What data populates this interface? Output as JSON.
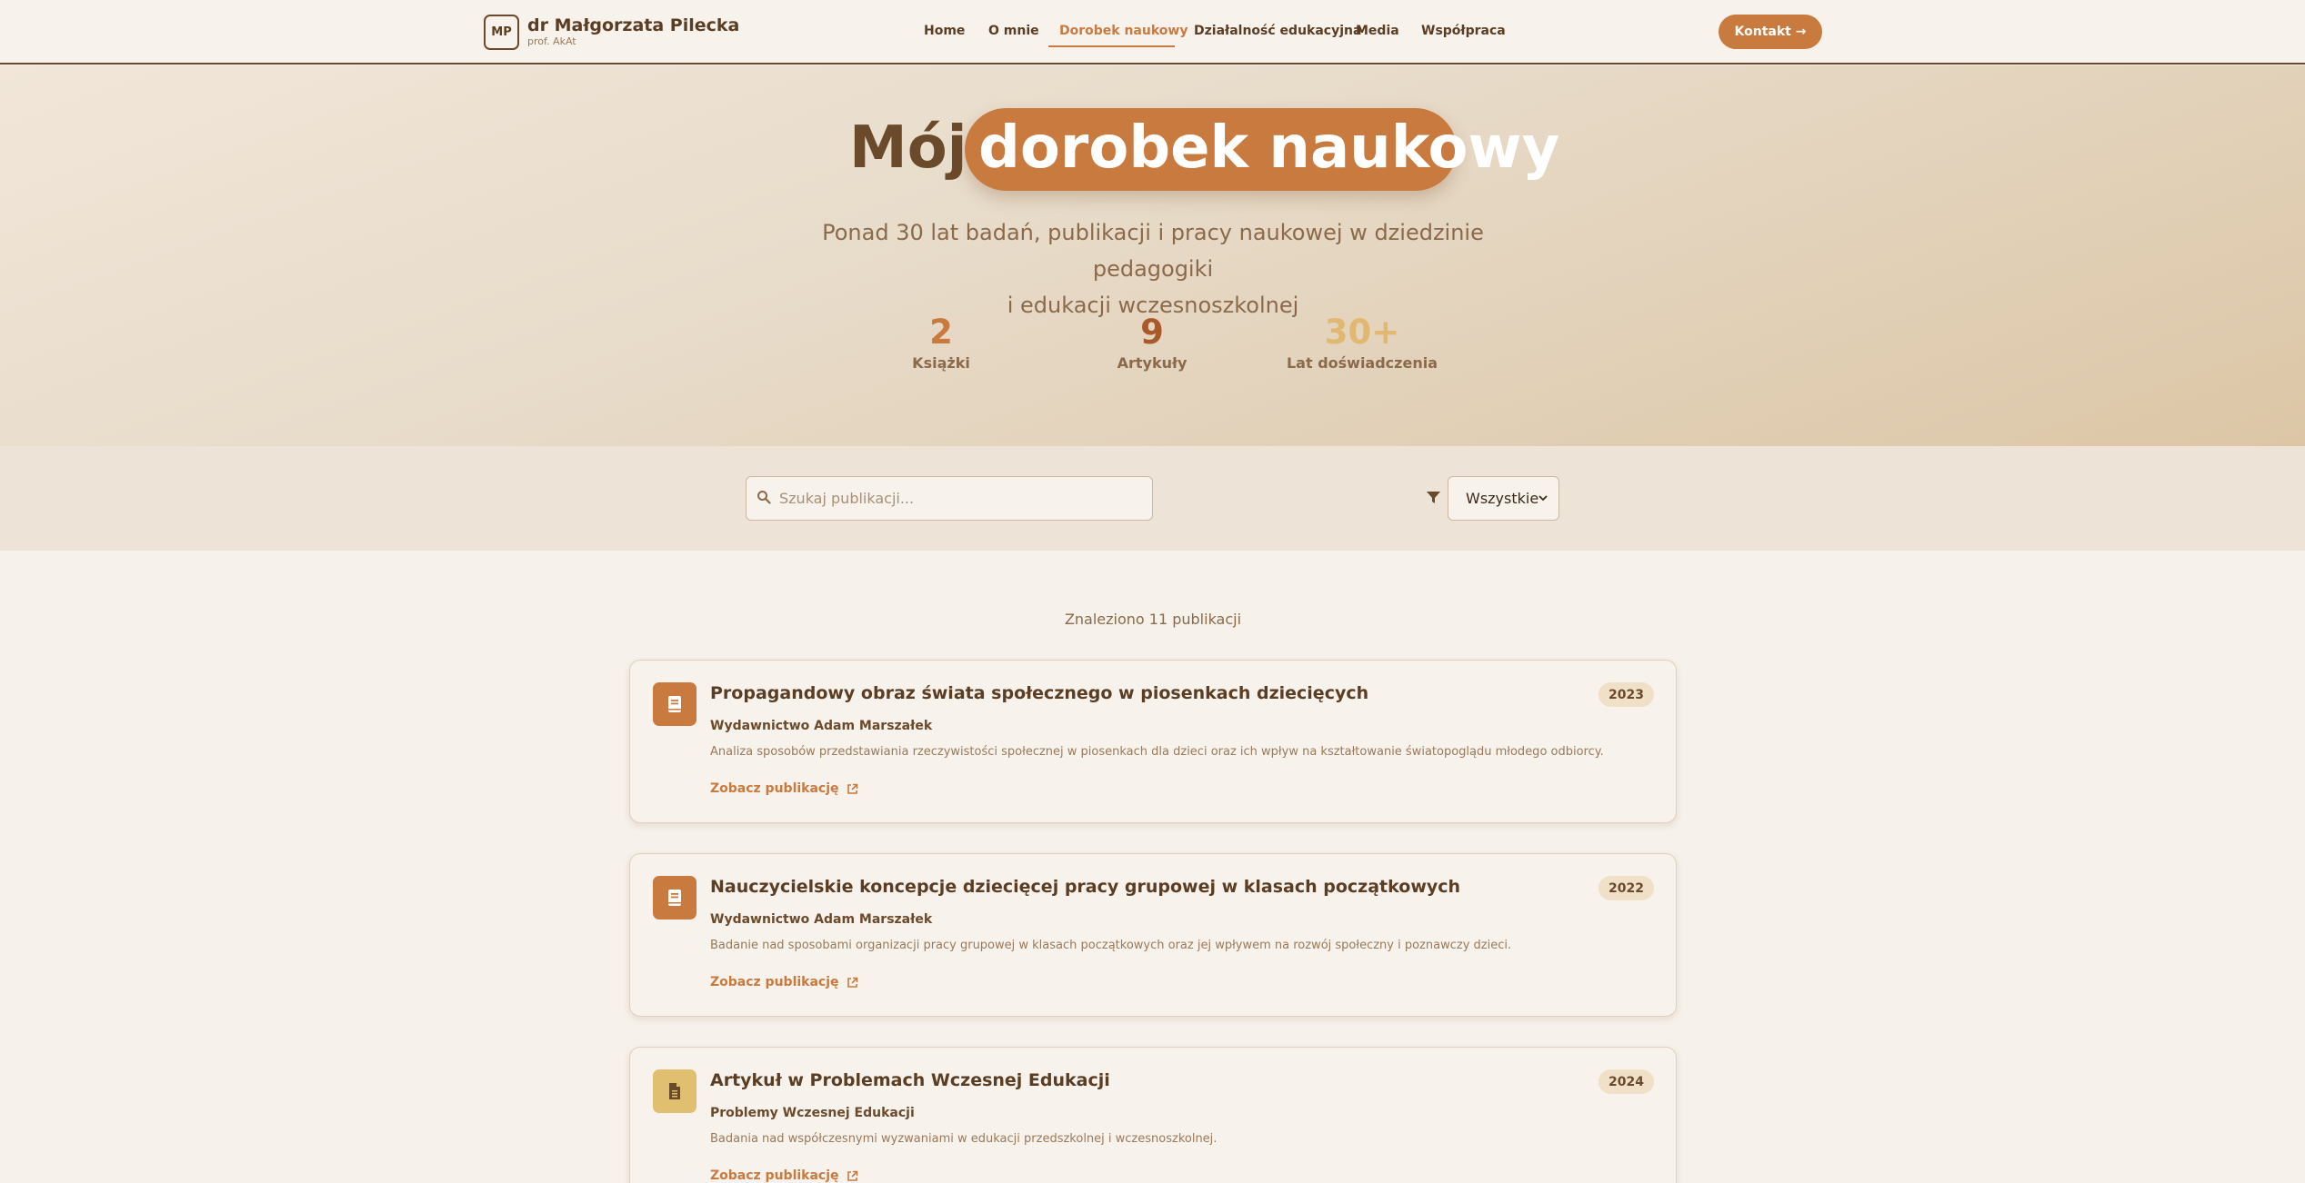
{
  "header": {
    "logo_initials": "MP",
    "brand_name": "dr Małgorzata Pilecka",
    "brand_sub": "prof. AkAt",
    "nav": [
      "Home",
      "O mnie",
      "Dorobek naukowy",
      "Działalność edukacyjna",
      "Media",
      "Współpraca"
    ],
    "active_nav": "Dorobek naukowy",
    "contact_label": "Kontakt →"
  },
  "hero": {
    "title_plain": "Mój",
    "title_highlight": "dorobek naukowy",
    "subtitle_line1": "Ponad 30 lat badań, publikacji i pracy naukowej w dziedzinie pedagogiki",
    "subtitle_line2": "i edukacji wczesnoszkolnej",
    "stats": [
      {
        "value": "2",
        "label": "Książki",
        "color": "#c97a3e"
      },
      {
        "value": "9",
        "label": "Artykuły",
        "color": "#a85a2a"
      },
      {
        "value": "30+",
        "label": "Lat doświadczenia",
        "color": "#e0b870"
      }
    ]
  },
  "filter": {
    "search_placeholder": "Szukaj publikacji...",
    "search_value": "",
    "category_selected": "Wszystkie"
  },
  "results": {
    "count_text": "Znaleziono 11 publikacji",
    "link_label": "Zobacz publikację",
    "items": [
      {
        "title": "Propagandowy obraz świata społecznego w piosenkach dziecięcych",
        "year": "2023",
        "publisher": "Wydawnictwo Adam Marszałek",
        "description": "Analiza sposobów przedstawiania rzeczywistości społecznej w piosenkach dla dzieci oraz ich wpływ na kształtowanie światopoglądu młodego odbiorcy.",
        "icon": "book-icon",
        "icon_color": "#c97a3e"
      },
      {
        "title": "Nauczycielskie koncepcje dziecięcej pracy grupowej w klasach początkowych",
        "year": "2022",
        "publisher": "Wydawnictwo Adam Marszałek",
        "description": "Badanie nad sposobami organizacji pracy grupowej w klasach początkowych oraz jej wpływem na rozwój społeczny i poznawczy dzieci.",
        "icon": "book-icon",
        "icon_color": "#c97a3e"
      },
      {
        "title": "Artykuł w Problemach Wczesnej Edukacji",
        "year": "2024",
        "publisher": "Problemy Wczesnej Edukacji",
        "description": "Badania nad współczesnymi wyzwaniami w edukacji przedszkolnej i wczesnoszkolnej.",
        "icon": "document-icon",
        "icon_color": "#e0c070"
      }
    ]
  }
}
